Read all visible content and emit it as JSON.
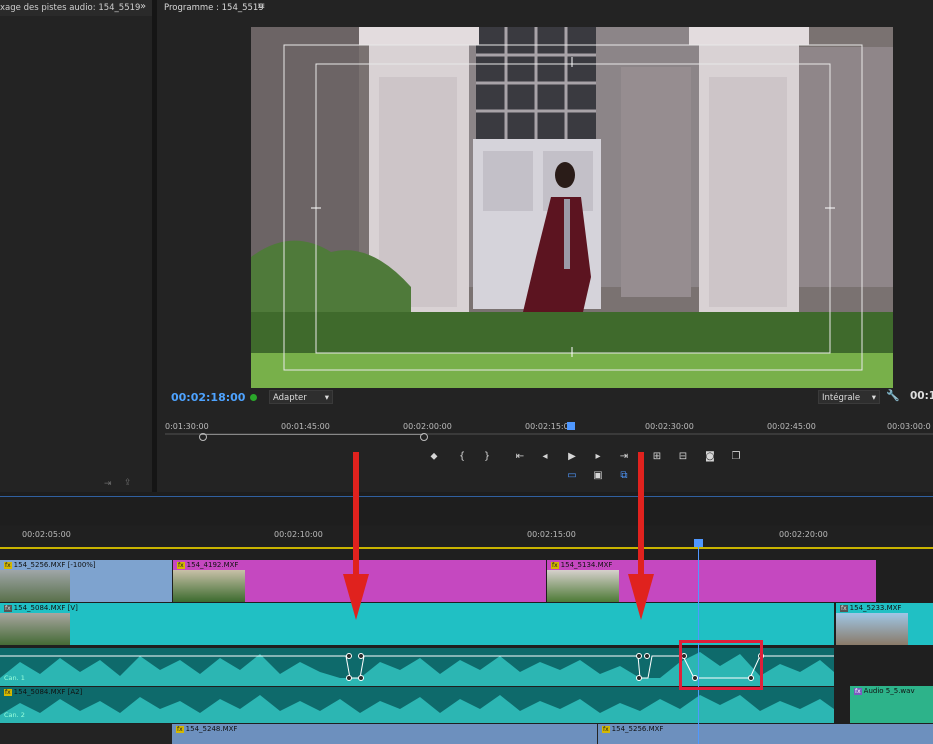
{
  "mixer": {
    "title": "xage des pistes audio: 154_5519",
    "expand_icon": "»"
  },
  "program": {
    "title": "Programme : 154_5519",
    "menu_icon": "≡",
    "timecode": "00:02:18:00",
    "zoom": "Adapter",
    "quality": "Intégrale",
    "duration_partial": "00:1",
    "ruler_ticks": [
      "0:01:30:00",
      "00:01:45:00",
      "00:02:00:00",
      "00:02:15:00",
      "00:02:30:00",
      "00:02:45:00",
      "00:03:00:0"
    ]
  },
  "timeline": {
    "ruler_ticks": [
      "00:02:05:00",
      "00:02:10:00",
      "00:02:15:00",
      "00:02:20:00"
    ],
    "clips": {
      "v2_a": "154_5256.MXF [-100%]",
      "v2_b": "154_4192.MXF",
      "v2_c": "154_5134.MXF",
      "v1_a": "154_5084.MXF [V]",
      "v1_b": "154_5233.MXF",
      "a1_label": "Can. 1",
      "a2_label": "154_5084.MXF [A2]",
      "a2_chan": "Can. 2",
      "audio5": "Audio 5_5.wav",
      "a3_a": "154_5248.MXF",
      "a3_b": "154_5256.MXF"
    }
  },
  "colors": {
    "accent_blue": "#4ea3ff",
    "magenta": "#c548c0",
    "teal": "#20c0c4",
    "audio_teal": "#0e6a6b",
    "red_marker": "#e0221e"
  }
}
